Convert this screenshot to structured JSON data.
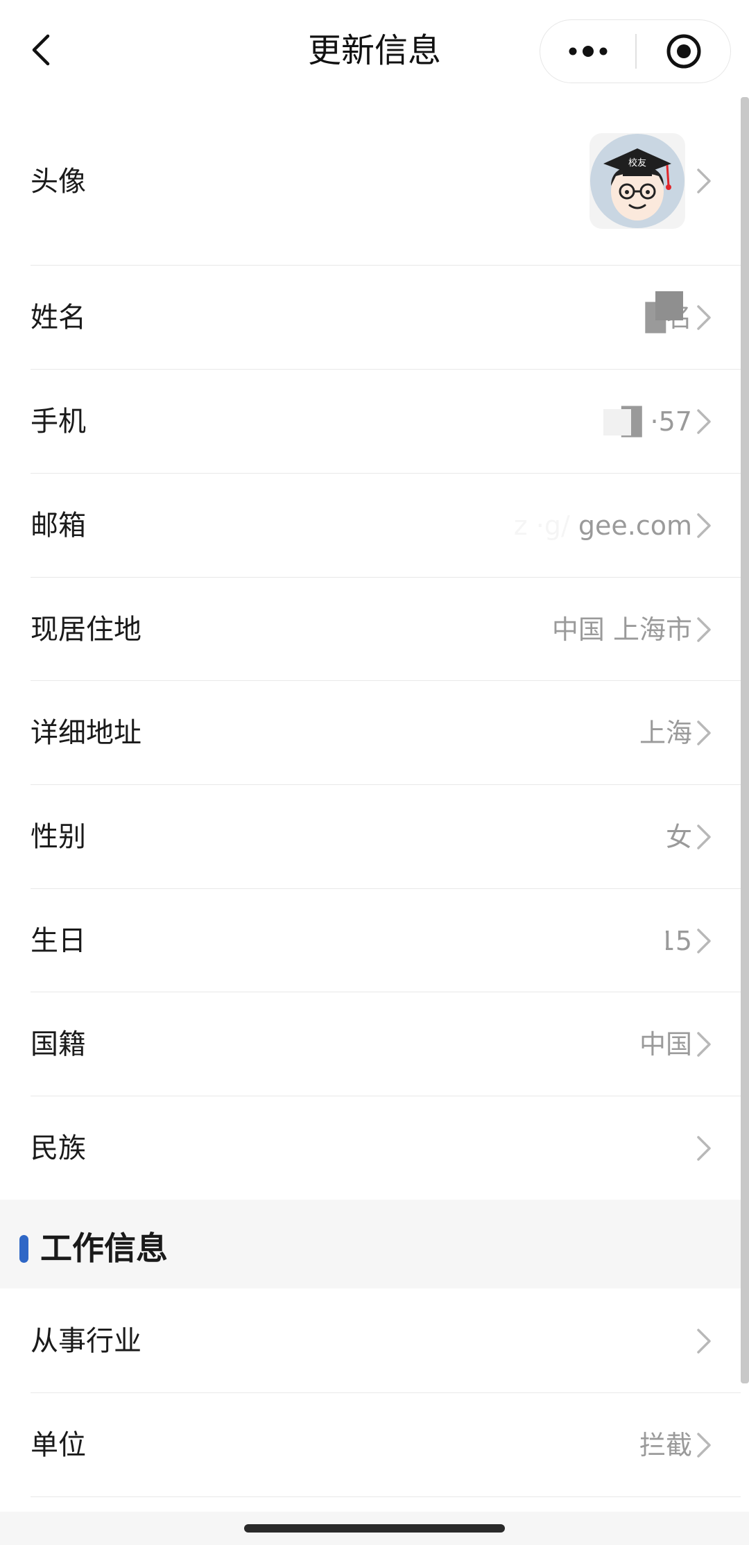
{
  "navbar": {
    "title": "更新信息",
    "back_icon": "chevron-left-icon",
    "more_icon": "more-dots-icon",
    "close_icon": "target-circle-icon"
  },
  "profile": {
    "avatar_label": "头像",
    "avatar_badge": "校友",
    "fields": [
      {
        "key": "name",
        "label": "姓名",
        "value": "█名"
      },
      {
        "key": "phone",
        "label": "手机",
        "value": "█  ·57"
      },
      {
        "key": "email",
        "label": "邮箱",
        "value": "z  ·g/       gee.com"
      },
      {
        "key": "residence",
        "label": "现居住地",
        "value": "中国 上海市"
      },
      {
        "key": "address",
        "label": "详细地址",
        "value": "上海"
      },
      {
        "key": "gender",
        "label": "性别",
        "value": "女"
      },
      {
        "key": "birthday",
        "label": "生日",
        "value": "20        15"
      },
      {
        "key": "nationality",
        "label": "国籍",
        "value": "中国"
      },
      {
        "key": "ethnicity",
        "label": "民族",
        "value": ""
      }
    ]
  },
  "work_section": {
    "title": "工作信息",
    "fields": [
      {
        "key": "industry",
        "label": "从事行业",
        "value": ""
      },
      {
        "key": "employer",
        "label": "单位",
        "value": "拦截"
      }
    ]
  },
  "colors": {
    "accent": "#2f67c6",
    "label": "#1a1a1a",
    "value": "#9a9a9a",
    "divider": "#e8e8e8",
    "section_bg": "#f6f6f6"
  }
}
